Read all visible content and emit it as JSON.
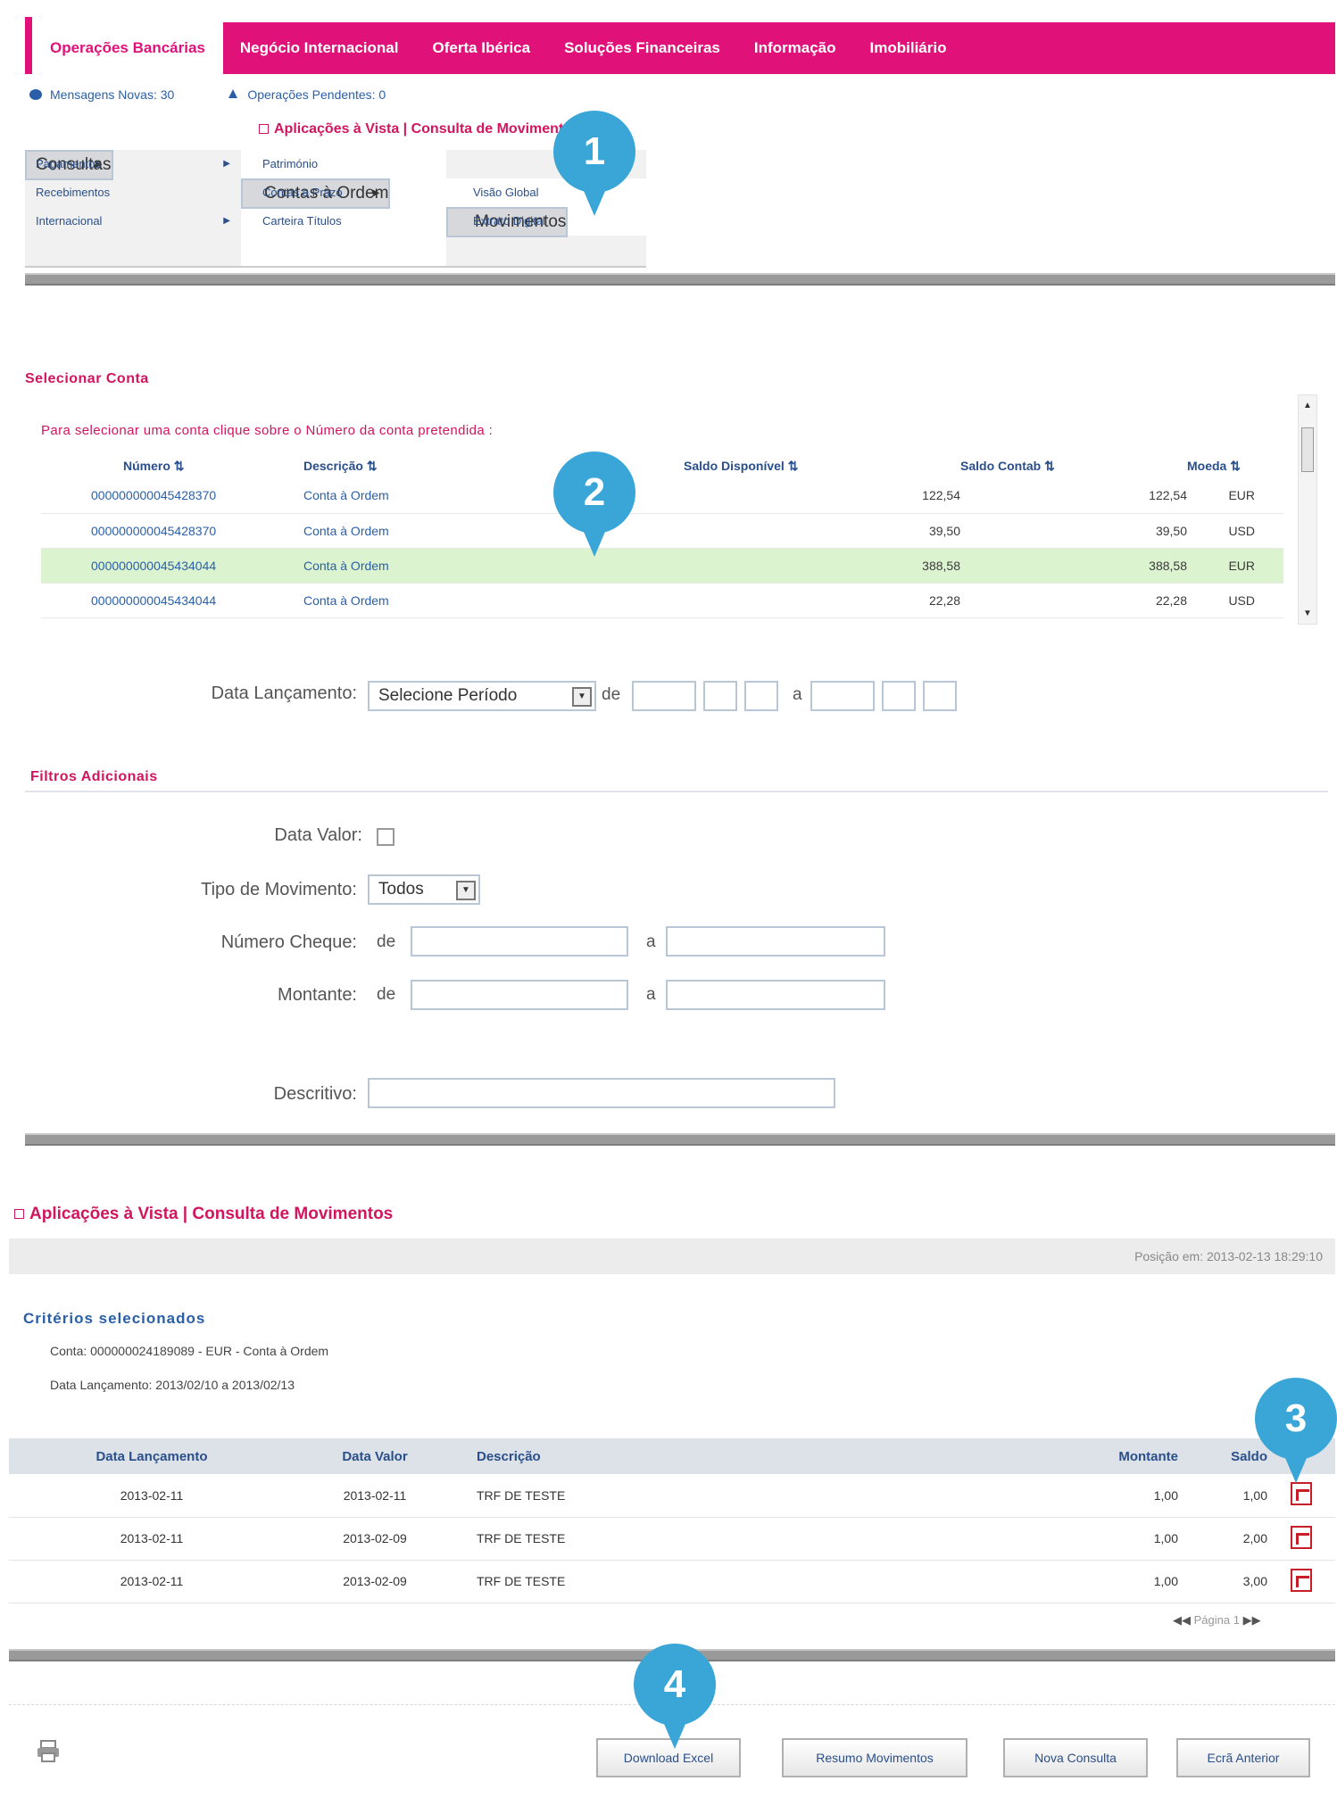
{
  "nav": {
    "tabs": [
      "Operações Bancárias",
      "Negócio Internacional",
      "Oferta Ibérica",
      "Soluções Financeiras",
      "Informação",
      "Imobiliário"
    ]
  },
  "info": {
    "messages": "Mensagens Novas: 30",
    "pending": "Operações Pendentes: 0"
  },
  "breadcrumb1": "Aplicações à Vista | Consulta de Movimentos",
  "menu": {
    "col1": [
      "Consultas",
      "Pagamentos",
      "Recebimentos",
      "Internacional"
    ],
    "col2": [
      "Património",
      "Contas à Ordem",
      "Contas a Prazo",
      "Carteira Títulos"
    ],
    "col3": [
      "Visão Global",
      "Movimentos",
      "Extrato Digital"
    ]
  },
  "select_account": {
    "title": "Selecionar Conta",
    "hint": "Para selecionar uma conta clique sobre o Número da conta pretendida :",
    "headers": [
      "Número ⇅",
      "Descrição ⇅",
      "Saldo Disponível ⇅",
      "Saldo Contab ⇅",
      "Moeda ⇅"
    ],
    "rows": [
      [
        "000000000045428370",
        "Conta à Ordem",
        "122,54",
        "122,54",
        "EUR"
      ],
      [
        "000000000045428370",
        "Conta à Ordem",
        "39,50",
        "39,50",
        "USD"
      ],
      [
        "000000000045434044",
        "Conta à Ordem",
        "388,58",
        "388,58",
        "EUR"
      ],
      [
        "000000000045434044",
        "Conta à Ordem",
        "22,28",
        "22,28",
        "USD"
      ]
    ]
  },
  "form": {
    "date_label": "Data Lançamento:",
    "period_value": "Selecione Período",
    "de": "de",
    "a": "a",
    "filters_title": "Filtros Adicionais",
    "data_valor_label": "Data Valor:",
    "tipo_label": "Tipo de Movimento:",
    "tipo_value": "Todos",
    "cheque_label": "Número Cheque:",
    "montante_label": "Montante:",
    "descritivo_label": "Descritivo:"
  },
  "results": {
    "breadcrumb": "Aplicações à Vista | Consulta de Movimentos",
    "position": "Posição em: 2013-02-13 18:29:10",
    "criteria_title": "Critérios selecionados",
    "criteria_account": "Conta: 000000024189089 - EUR - Conta à Ordem",
    "criteria_date": "Data Lançamento: 2013/02/10 a 2013/02/13",
    "headers": [
      "Data Lançamento",
      "Data Valor",
      "Descrição",
      "Montante",
      "Saldo"
    ],
    "rows": [
      [
        "2013-02-11",
        "2013-02-11",
        "TRF DE TESTE",
        "1,00",
        "1,00"
      ],
      [
        "2013-02-11",
        "2013-02-09",
        "TRF DE TESTE",
        "1,00",
        "2,00"
      ],
      [
        "2013-02-11",
        "2013-02-09",
        "TRF DE TESTE",
        "1,00",
        "3,00"
      ]
    ],
    "pagination": "Página 1"
  },
  "buttons": {
    "excel": "Download Excel",
    "summary": "Resumo Movimentos",
    "new": "Nova Consulta",
    "prev": "Ecrã Anterior"
  },
  "markers": [
    "1",
    "2",
    "3",
    "4"
  ],
  "colors": {
    "brand": "#e0127a",
    "marker": "#3aa6d8",
    "highlight_row": "#dcf3d0"
  }
}
